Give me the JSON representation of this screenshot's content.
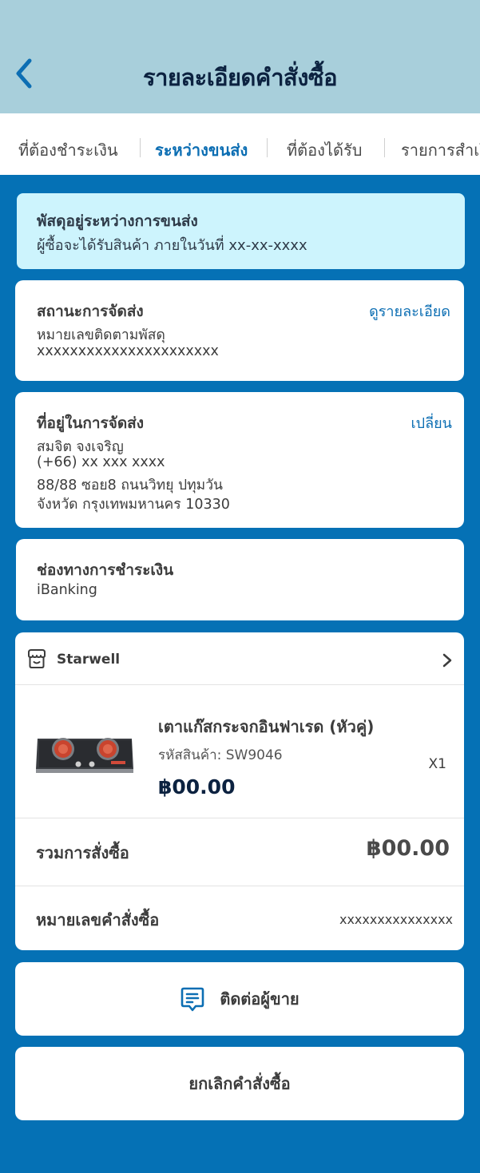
{
  "header": {
    "title": "รายละเอียดคำสั่งซื้อ",
    "back_icon": "chevron-left-icon"
  },
  "tabs": [
    {
      "label": "ที่ต้องชำระเงิน",
      "active": false
    },
    {
      "label": "ระหว่างขนส่ง",
      "active": true
    },
    {
      "label": "ที่ต้องได้รับ",
      "active": false
    },
    {
      "label": "รายการสำเร็จ",
      "active": false
    }
  ],
  "notice": {
    "title": "พัสดุอยู่ระหว่างการขนส่ง",
    "subtitle": "ผู้ซื้อจะได้รับสินค้า ภายในวันที่ xx-xx-xxxx"
  },
  "shipping_status": {
    "title": "สถานะการจัดส่ง",
    "link": "ดูรายละเอียด",
    "tracking_label": "หมายเลขติดตามพัสดุ",
    "tracking_number": "xxxxxxxxxxxxxxxxxxxxxx"
  },
  "address": {
    "title": "ที่อยู่ในการจัดส่ง",
    "link": "เปลี่ยน",
    "name": "สมจิต จงเจริญ",
    "phone": "(+66) xx xxx xxxx",
    "line1": "88/88 ซอย8 ถนนวิทยุ ปทุมวัน",
    "line2": "จังหวัด กรุงเทพมหานคร 10330"
  },
  "payment": {
    "title": "ช่องทางการชำระเงิน",
    "method": "iBanking"
  },
  "order": {
    "shop_name": "Starwell",
    "shop_icon": "store-icon",
    "chevron_icon": "chevron-right-icon",
    "product": {
      "name": "เตาแก๊สกระจกอินฟาเรด (หัวคู่)",
      "sku": "รหัสสินค้า: SW9046",
      "price": "฿00.00",
      "qty": "X1"
    },
    "total_label": "รวมการสั่งซื้อ",
    "total_value": "฿00.00",
    "order_no_label": "หมายเลขคำสั่งซื้อ",
    "order_no_value": "xxxxxxxxxxxxxxx"
  },
  "actions": {
    "contact_label": "ติดต่อผู้ขาย",
    "contact_icon": "chat-icon",
    "cancel_label": "ยกเลิกคำสั่งซื้อ"
  },
  "colors": {
    "background": "#0571b5",
    "header": "#a8cfdb",
    "accent": "#0c6eb3",
    "notice": "#cdf4fd",
    "title_dark": "#0c2240"
  }
}
